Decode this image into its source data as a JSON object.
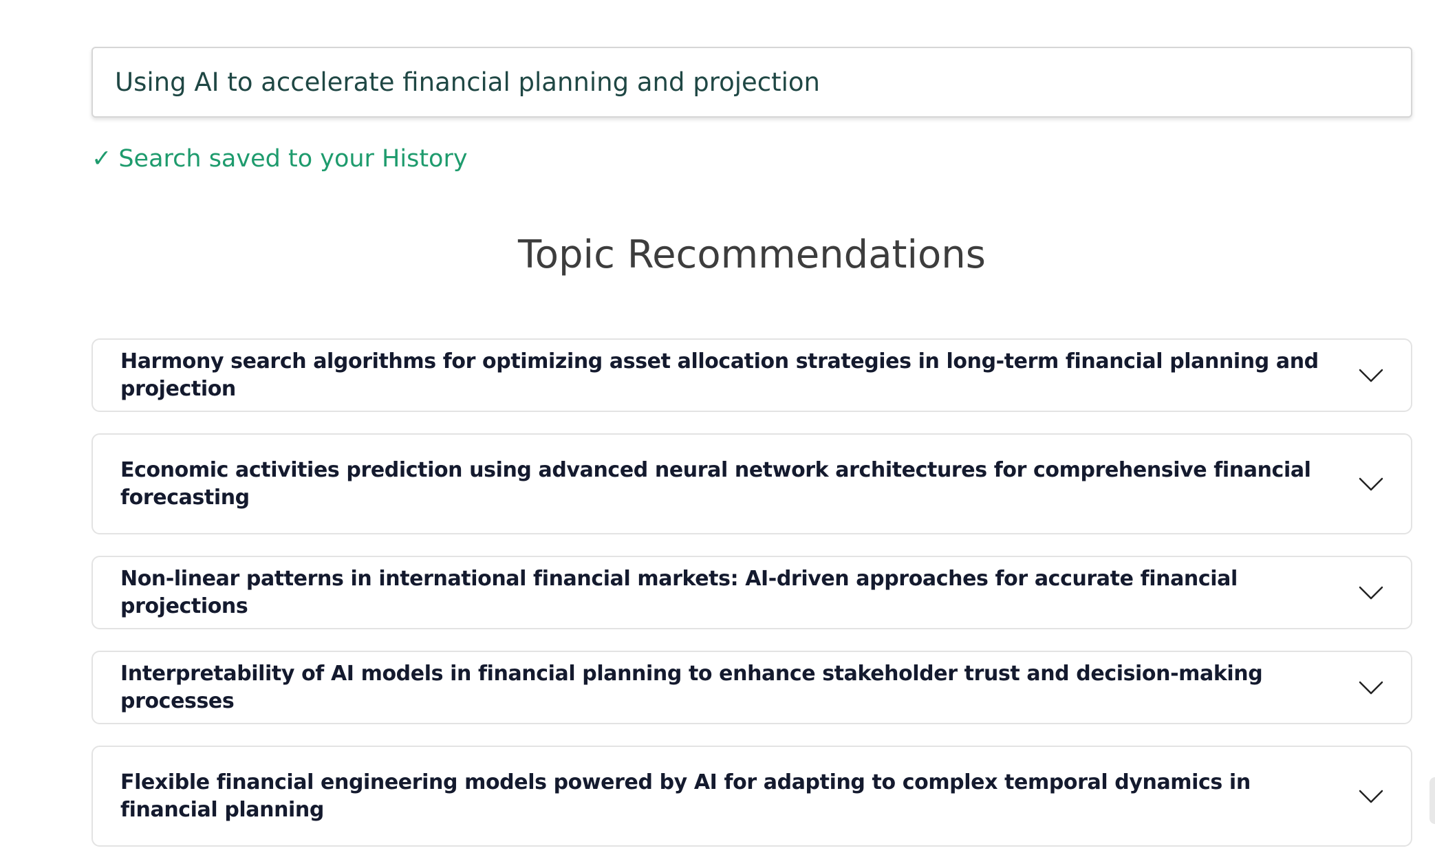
{
  "search": {
    "value": "Using AI to accelerate financial planning and projection"
  },
  "saved_note": {
    "check": "✓",
    "text": "Search saved to your History"
  },
  "section": {
    "title": "Topic Recommendations"
  },
  "topics": [
    {
      "title": "Harmony search algorithms for optimizing asset allocation strategies in long-term financial planning and projection"
    },
    {
      "title": "Economic activities prediction using advanced neural network architectures for comprehensive financial forecasting"
    },
    {
      "title": "Non-linear patterns in international financial markets: AI-driven approaches for accurate financial projections"
    },
    {
      "title": "Interpretability of AI models in financial planning to enhance stakeholder trust and decision-making processes"
    },
    {
      "title": "Flexible financial engineering models powered by AI for adapting to complex temporal dynamics in financial planning"
    }
  ],
  "colors": {
    "accent_green": "#1e9b6d",
    "search_text": "#1f4744",
    "title_text": "#3d3d3d",
    "topic_text": "#141a2e"
  },
  "icons": {
    "expand": "chevron-down-icon",
    "saved": "check-icon"
  }
}
